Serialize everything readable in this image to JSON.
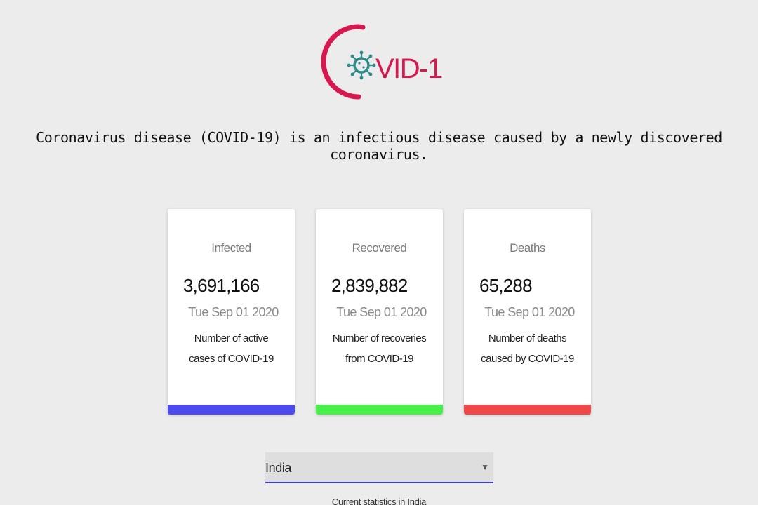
{
  "header": {
    "logo_alt": "COVID-19",
    "tagline": "Coronavirus disease (COVID-19) is an infectious disease caused by a newly discovered coronavirus."
  },
  "cards": [
    {
      "title": "Infected",
      "value": "3,691,166",
      "date": "Tue Sep 01 2020",
      "description": "Number of active cases of COVID-19",
      "color": "#4b4bf0"
    },
    {
      "title": "Recovered",
      "value": "2,839,882",
      "date": "Tue Sep 01 2020",
      "description": "Number of recoveries from COVID-19",
      "color": "#46f046"
    },
    {
      "title": "Deaths",
      "value": "65,288",
      "date": "Tue Sep 01 2020",
      "description": "Number of deaths caused by COVID-19",
      "color": "#f04848"
    }
  ],
  "country_select": {
    "selected": "India",
    "arrow_icon": "chevron-down-icon"
  },
  "footer": {
    "current_stats": "Current statistics in India"
  },
  "colors": {
    "logo_ring": "#d6184f",
    "logo_virus": "#2e8b8b",
    "background": "#ececec",
    "select_underline": "#3f3fcf"
  }
}
